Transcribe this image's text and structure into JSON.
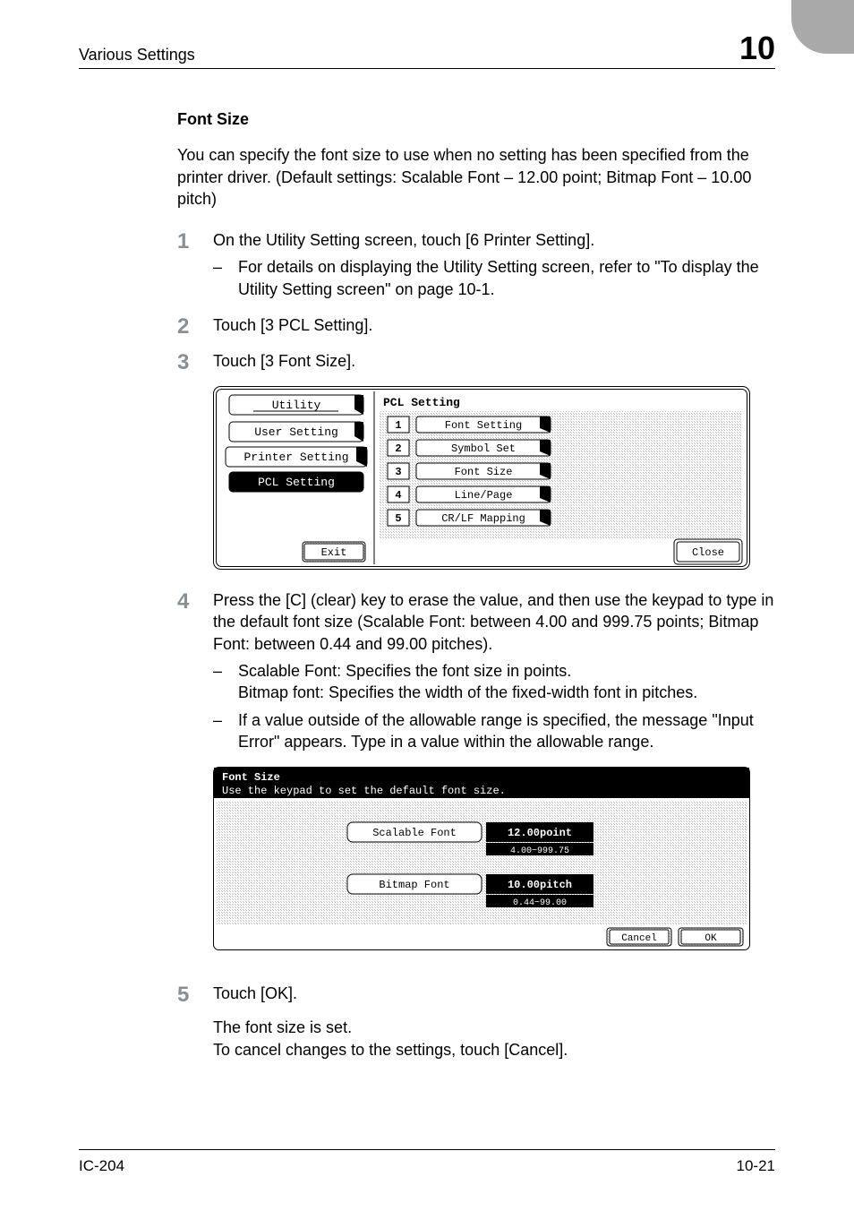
{
  "header": {
    "left": "Various Settings",
    "right": "10"
  },
  "section": {
    "title": "Font Size",
    "intro": "You can specify the font size to use when no setting has been specified from the printer driver. (Default settings: Scalable Font – 12.00 point; Bitmap Font – 10.00 pitch)"
  },
  "steps": {
    "s1": {
      "num": "1",
      "text": "On the Utility Setting screen, touch [6 Printer Setting].",
      "sub1": "For details on displaying the Utility Setting screen, refer to \"To display the Utility Setting screen\" on page 10-1."
    },
    "s2": {
      "num": "2",
      "text": "Touch [3 PCL Setting]."
    },
    "s3": {
      "num": "3",
      "text": "Touch [3 Font Size]."
    },
    "s4": {
      "num": "4",
      "text": "Press the [C] (clear) key to erase the value, and then use the keypad to type in the default font size (Scalable Font: between 4.00 and 999.75 points; Bitmap Font: between 0.44 and 99.00 pitches).",
      "sub1a": "Scalable Font: Specifies the font size in points.",
      "sub1b": "Bitmap font: Specifies the width of the fixed-width font in pitches.",
      "sub2": "If a value outside of the allowable range is specified, the message \"Input Error\" appears. Type in a value within the allowable range."
    },
    "s5": {
      "num": "5",
      "text": "Touch [OK].",
      "line1": "The font size is set.",
      "line2": "To cancel changes to the settings, touch [Cancel]."
    }
  },
  "fig1": {
    "title": "PCL Setting",
    "side": {
      "utility": "Utility",
      "user": "User Setting",
      "printer": "Printer Setting",
      "pcl": "PCL Setting",
      "exit": "Exit"
    },
    "items": {
      "n1": "1",
      "l1": "Font Setting",
      "n2": "2",
      "l2": "Symbol Set",
      "n3": "3",
      "l3": "Font Size",
      "n4": "4",
      "l4": "Line/Page",
      "n5": "5",
      "l5": "CR/LF Mapping"
    },
    "close": "Close"
  },
  "fig2": {
    "title": "Font Size",
    "subtitle": "Use the keypad to set the default font size.",
    "scalable_label": "Scalable Font",
    "scalable_value": "12.00point",
    "scalable_range": "4.00~999.75",
    "bitmap_label": "Bitmap Font",
    "bitmap_value": "10.00pitch",
    "bitmap_range": "0.44~99.00",
    "cancel": "Cancel",
    "ok": "OK"
  },
  "footer": {
    "left": "IC-204",
    "right": "10-21"
  }
}
